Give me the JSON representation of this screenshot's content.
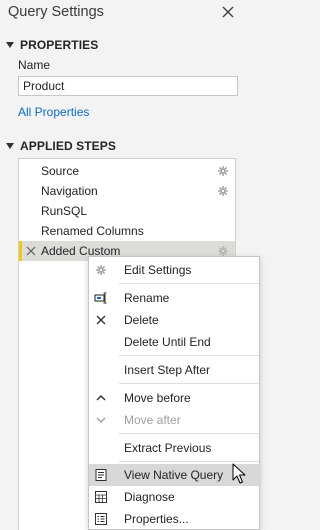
{
  "header": {
    "title": "Query Settings",
    "close_icon": "close-icon"
  },
  "properties": {
    "heading": "PROPERTIES",
    "name_label": "Name",
    "name_value": "Product",
    "all_properties_link": "All Properties"
  },
  "applied_steps": {
    "heading": "APPLIED STEPS",
    "steps": [
      {
        "label": "Source",
        "has_gear": true
      },
      {
        "label": "Navigation",
        "has_gear": true
      },
      {
        "label": "RunSQL",
        "has_gear": false
      },
      {
        "label": "Renamed Columns",
        "has_gear": false
      },
      {
        "label": "Added Custom",
        "has_gear": true,
        "selected": true
      }
    ]
  },
  "context_menu": {
    "items": [
      {
        "label": "Edit Settings",
        "icon": "gear-icon",
        "enabled": true
      },
      {
        "label": "Rename",
        "icon": "rename-icon",
        "enabled": true
      },
      {
        "label": "Delete",
        "icon": "delete-x-icon",
        "enabled": true
      },
      {
        "label": "Delete Until End",
        "icon": "",
        "enabled": true
      },
      {
        "label": "Insert Step After",
        "icon": "",
        "enabled": true
      },
      {
        "label": "Move before",
        "icon": "chevron-up-icon",
        "enabled": true
      },
      {
        "label": "Move after",
        "icon": "chevron-down-icon",
        "enabled": false
      },
      {
        "label": "Extract Previous",
        "icon": "",
        "enabled": true
      },
      {
        "label": "View Native Query",
        "icon": "native-query-icon",
        "enabled": true,
        "hovered": true
      },
      {
        "label": "Diagnose",
        "icon": "diagnose-icon",
        "enabled": true
      },
      {
        "label": "Properties...",
        "icon": "properties-icon",
        "enabled": true
      }
    ]
  },
  "colors": {
    "panel_bg": "#f3f3f3",
    "link": "#0f6cbd",
    "selected_step_bg": "#dedcd9",
    "selected_step_accent": "#f2c811",
    "menu_hover_bg": "#d8d8d8",
    "disabled_text": "#a19f9d"
  }
}
